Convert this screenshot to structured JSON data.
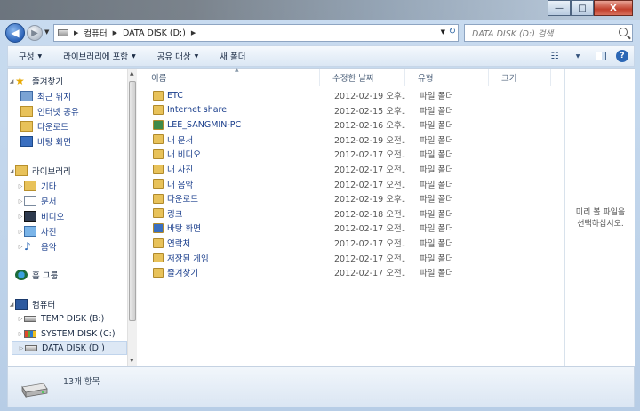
{
  "window": {
    "caption": {
      "minimize": "—",
      "maximize": "□",
      "close": "X"
    }
  },
  "nav": {
    "back_icon": "back-arrow-icon",
    "forward_icon": "forward-arrow-icon"
  },
  "address": {
    "crumbs": [
      "컴퓨터",
      "DATA DISK (D:)"
    ]
  },
  "search": {
    "placeholder": "DATA DISK (D:) 검색"
  },
  "toolbar": {
    "organize": "구성",
    "include_library": "라이브러리에 포함",
    "share_with": "공유 대상",
    "new_folder": "새 폴더"
  },
  "sidebar": {
    "favorites": {
      "label": "즐겨찾기",
      "items": [
        "최근 위치",
        "인터넷 공유",
        "다운로드",
        "바탕 화면"
      ]
    },
    "libraries": {
      "label": "라이브러리",
      "items": [
        "기타",
        "문서",
        "비디오",
        "사진",
        "음악"
      ]
    },
    "homegroup": {
      "label": "홈 그룹"
    },
    "computer": {
      "label": "컴퓨터",
      "items": [
        "TEMP DISK (B:)",
        "SYSTEM DISK (C:)",
        "DATA DISK (D:)"
      ]
    }
  },
  "columns": {
    "name": "이름",
    "date": "수정한 날짜",
    "type": "유형",
    "size": "크기"
  },
  "files": [
    {
      "name": "ETC",
      "date": "2012-02-19 오후...",
      "type": "파일 폴더",
      "icon": "folder"
    },
    {
      "name": "Internet share",
      "date": "2012-02-15 오후...",
      "type": "파일 폴더",
      "icon": "share-folder"
    },
    {
      "name": "LEE_SANGMIN-PC",
      "date": "2012-02-16 오후...",
      "type": "파일 폴더",
      "icon": "network-folder"
    },
    {
      "name": "내 문서",
      "date": "2012-02-19 오전...",
      "type": "파일 폴더",
      "icon": "documents-folder"
    },
    {
      "name": "내 비디오",
      "date": "2012-02-17 오전...",
      "type": "파일 폴더",
      "icon": "videos-folder"
    },
    {
      "name": "내 사진",
      "date": "2012-02-17 오전...",
      "type": "파일 폴더",
      "icon": "pictures-folder"
    },
    {
      "name": "내 음악",
      "date": "2012-02-17 오전...",
      "type": "파일 폴더",
      "icon": "music-folder"
    },
    {
      "name": "다운로드",
      "date": "2012-02-19 오후...",
      "type": "파일 폴더",
      "icon": "downloads-folder"
    },
    {
      "name": "링크",
      "date": "2012-02-18 오전...",
      "type": "파일 폴더",
      "icon": "links-folder"
    },
    {
      "name": "바탕 화면",
      "date": "2012-02-17 오전...",
      "type": "파일 폴더",
      "icon": "desktop-folder"
    },
    {
      "name": "연락처",
      "date": "2012-02-17 오전...",
      "type": "파일 폴더",
      "icon": "contacts-folder"
    },
    {
      "name": "저장된 게임",
      "date": "2012-02-17 오전...",
      "type": "파일 폴더",
      "icon": "games-folder"
    },
    {
      "name": "즐겨찾기",
      "date": "2012-02-17 오전...",
      "type": "파일 폴더",
      "icon": "favorites-folder"
    }
  ],
  "preview": {
    "line1": "미리 볼 파일을",
    "line2": "선택하십시오."
  },
  "details": {
    "count": "13개 항목"
  },
  "colors": {
    "link": "#1a3e8c",
    "folder": "#e8c25a",
    "accent": "#2c67b5"
  }
}
